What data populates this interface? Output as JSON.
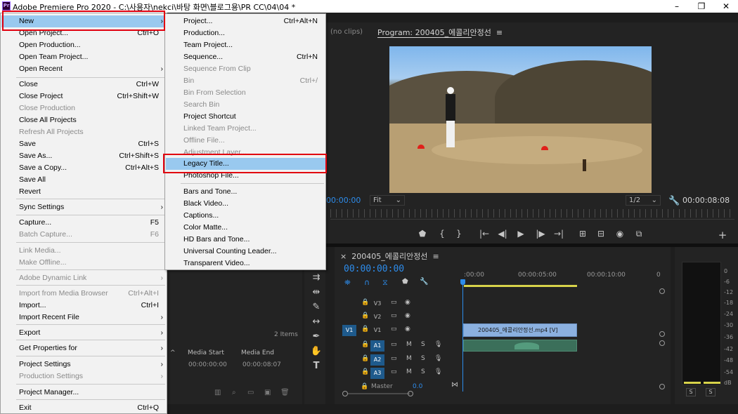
{
  "window": {
    "title": "Adobe Premiere Pro 2020 - C:\\사용자\\nekci\\바탕 화면\\블로그용\\PR CC\\04\\04 *",
    "minimize": "–",
    "maximize": "❐",
    "close": "✕"
  },
  "file_menu": {
    "items": [
      {
        "label": "New",
        "shortcut": "",
        "arrow": "›",
        "disabled": false,
        "highlight": true
      },
      {
        "label": "Open Project...",
        "shortcut": "Ctrl+O",
        "arrow": "",
        "disabled": false
      },
      {
        "label": "Open Production...",
        "shortcut": "",
        "arrow": "",
        "disabled": false
      },
      {
        "label": "Open Team Project...",
        "shortcut": "",
        "arrow": "",
        "disabled": false
      },
      {
        "label": "Open Recent",
        "shortcut": "",
        "arrow": "›",
        "disabled": false
      },
      {
        "label": "Close",
        "shortcut": "Ctrl+W",
        "arrow": "",
        "disabled": false
      },
      {
        "label": "Close Project",
        "shortcut": "Ctrl+Shift+W",
        "arrow": "",
        "disabled": false
      },
      {
        "label": "Close Production",
        "shortcut": "",
        "arrow": "",
        "disabled": true
      },
      {
        "label": "Close All Projects",
        "shortcut": "",
        "arrow": "",
        "disabled": false
      },
      {
        "label": "Refresh All Projects",
        "shortcut": "",
        "arrow": "",
        "disabled": true
      },
      {
        "label": "Save",
        "shortcut": "Ctrl+S",
        "arrow": "",
        "disabled": false
      },
      {
        "label": "Save As...",
        "shortcut": "Ctrl+Shift+S",
        "arrow": "",
        "disabled": false
      },
      {
        "label": "Save a Copy...",
        "shortcut": "Ctrl+Alt+S",
        "arrow": "",
        "disabled": false
      },
      {
        "label": "Save All",
        "shortcut": "",
        "arrow": "",
        "disabled": false
      },
      {
        "label": "Revert",
        "shortcut": "",
        "arrow": "",
        "disabled": false
      },
      {
        "label": "Sync Settings",
        "shortcut": "",
        "arrow": "›",
        "disabled": false
      },
      {
        "label": "Capture...",
        "shortcut": "F5",
        "arrow": "",
        "disabled": false
      },
      {
        "label": "Batch Capture...",
        "shortcut": "F6",
        "arrow": "",
        "disabled": true
      },
      {
        "label": "Link Media...",
        "shortcut": "",
        "arrow": "",
        "disabled": true
      },
      {
        "label": "Make Offline...",
        "shortcut": "",
        "arrow": "",
        "disabled": true
      },
      {
        "label": "Adobe Dynamic Link",
        "shortcut": "",
        "arrow": "›",
        "disabled": true
      },
      {
        "label": "Import from Media Browser",
        "shortcut": "Ctrl+Alt+I",
        "arrow": "",
        "disabled": true
      },
      {
        "label": "Import...",
        "shortcut": "Ctrl+I",
        "arrow": "",
        "disabled": false
      },
      {
        "label": "Import Recent File",
        "shortcut": "",
        "arrow": "›",
        "disabled": false
      },
      {
        "label": "Export",
        "shortcut": "",
        "arrow": "›",
        "disabled": false
      },
      {
        "label": "Get Properties for",
        "shortcut": "",
        "arrow": "›",
        "disabled": false
      },
      {
        "label": "Project Settings",
        "shortcut": "",
        "arrow": "›",
        "disabled": false
      },
      {
        "label": "Production Settings",
        "shortcut": "",
        "arrow": "›",
        "disabled": true
      },
      {
        "label": "Project Manager...",
        "shortcut": "",
        "arrow": "",
        "disabled": false
      },
      {
        "label": "Exit",
        "shortcut": "Ctrl+Q",
        "arrow": "",
        "disabled": false
      }
    ]
  },
  "new_submenu": {
    "items": [
      {
        "label": "Project...",
        "shortcut": "Ctrl+Alt+N",
        "disabled": false
      },
      {
        "label": "Production...",
        "shortcut": "",
        "disabled": false
      },
      {
        "label": "Team Project...",
        "shortcut": "",
        "disabled": false
      },
      {
        "label": "Sequence...",
        "shortcut": "Ctrl+N",
        "disabled": false
      },
      {
        "label": "Sequence From Clip",
        "shortcut": "",
        "disabled": true
      },
      {
        "label": "Bin",
        "shortcut": "Ctrl+/",
        "disabled": true
      },
      {
        "label": "Bin From Selection",
        "shortcut": "",
        "disabled": true
      },
      {
        "label": "Search Bin",
        "shortcut": "",
        "disabled": true
      },
      {
        "label": "Project Shortcut",
        "shortcut": "",
        "disabled": false
      },
      {
        "label": "Linked Team Project...",
        "shortcut": "",
        "disabled": true
      },
      {
        "label": "Offline File...",
        "shortcut": "",
        "disabled": true
      },
      {
        "label": "Adjustment Layer...",
        "shortcut": "",
        "disabled": true
      },
      {
        "label": "Legacy Title...",
        "shortcut": "",
        "disabled": false,
        "highlight": true
      },
      {
        "label": "Photoshop File...",
        "shortcut": "",
        "disabled": false
      },
      {
        "label": "Bars and Tone...",
        "shortcut": "",
        "disabled": false
      },
      {
        "label": "Black Video...",
        "shortcut": "",
        "disabled": false
      },
      {
        "label": "Captions...",
        "shortcut": "",
        "disabled": false
      },
      {
        "label": "Color Matte...",
        "shortcut": "",
        "disabled": false
      },
      {
        "label": "HD Bars and Tone...",
        "shortcut": "",
        "disabled": false
      },
      {
        "label": "Universal Counting Leader...",
        "shortcut": "",
        "disabled": false
      },
      {
        "label": "Transparent Video...",
        "shortcut": "",
        "disabled": false
      }
    ]
  },
  "source_monitor": {
    "no_clips": "(no clips)"
  },
  "program_monitor": {
    "tab_label": "Program: 200405_에콜리안정선",
    "tab_menu": "≡",
    "timecode_left": "00:00:00",
    "fit": "Fit",
    "resolution": "1/2",
    "timecode_right": "00:00:08:08",
    "transport": [
      "⬟",
      "{",
      "}",
      "|←",
      "◀|",
      "▶",
      "|▶",
      "→|",
      "⊞",
      "⊟",
      "◉",
      "⧉",
      "+"
    ]
  },
  "project_panel": {
    "item_count": "2 Items",
    "columns": [
      "Media Start",
      "Media End"
    ],
    "row": [
      "00:00:00:00",
      "00:00:08:07"
    ]
  },
  "timeline": {
    "sequence_tab": "200405_에콜리안정선",
    "close": "×",
    "tab_menu": "≡",
    "timecode": "00:00:00:00",
    "ruler": [
      ":00:00",
      "00:00:05:00",
      "00:00:10:00",
      "0"
    ],
    "tracks": [
      {
        "src": "",
        "name": "V3",
        "toggle": "▭",
        "vis": "◉"
      },
      {
        "src": "",
        "name": "V2",
        "toggle": "▭",
        "vis": "◉"
      },
      {
        "src": "V1",
        "name": "V1",
        "toggle": "▭",
        "vis": "◉"
      },
      {
        "src": "",
        "name": "A1",
        "toggle": "▭",
        "m": "M",
        "s": "S",
        "mic": "🎙"
      },
      {
        "src": "",
        "name": "A2",
        "toggle": "▭",
        "m": "M",
        "s": "S",
        "mic": "🎙"
      },
      {
        "src": "",
        "name": "A3",
        "toggle": "▭",
        "m": "M",
        "s": "S",
        "mic": "🎙"
      }
    ],
    "master_label": "Master",
    "master_value": "0.0",
    "video_clip": "200405_에콜리안정선.mp4 [V]"
  },
  "audio_meter": {
    "db": [
      "0",
      "-6",
      "-12",
      "-18",
      "-24",
      "-30",
      "-36",
      "-42",
      "-48",
      "-54",
      "dB"
    ],
    "solo": [
      "S",
      "S"
    ]
  },
  "colors": {
    "accent_blue": "#2d8ceb",
    "menu_highlight": "#99c9ef",
    "annotation_red": "#e1000f",
    "clip_video": "#8bb0df",
    "clip_audio": "#3b6f5a"
  }
}
